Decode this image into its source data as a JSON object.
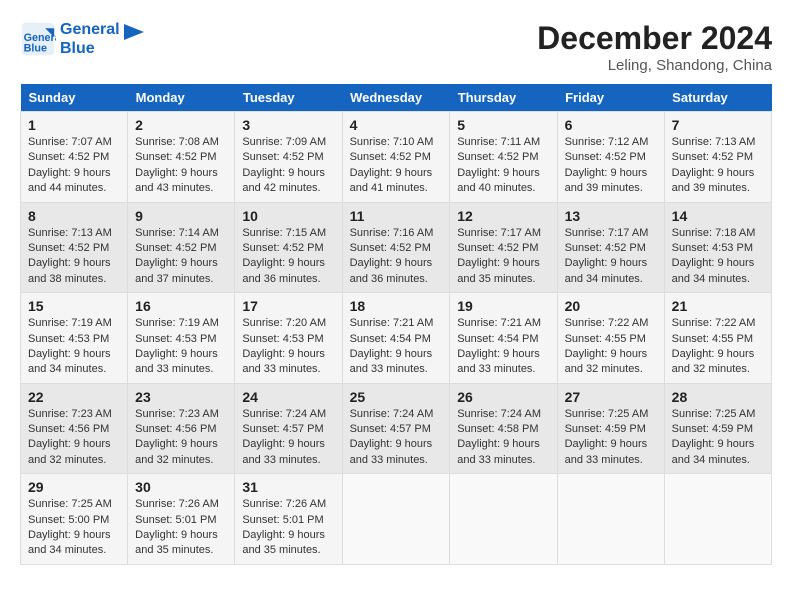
{
  "header": {
    "logo_line1": "General",
    "logo_line2": "Blue",
    "month_title": "December 2024",
    "location": "Leling, Shandong, China"
  },
  "weekdays": [
    "Sunday",
    "Monday",
    "Tuesday",
    "Wednesday",
    "Thursday",
    "Friday",
    "Saturday"
  ],
  "weeks": [
    [
      {
        "day": 1,
        "sunrise": "7:07 AM",
        "sunset": "4:52 PM",
        "daylight": "9 hours and 44 minutes."
      },
      {
        "day": 2,
        "sunrise": "7:08 AM",
        "sunset": "4:52 PM",
        "daylight": "9 hours and 43 minutes."
      },
      {
        "day": 3,
        "sunrise": "7:09 AM",
        "sunset": "4:52 PM",
        "daylight": "9 hours and 42 minutes."
      },
      {
        "day": 4,
        "sunrise": "7:10 AM",
        "sunset": "4:52 PM",
        "daylight": "9 hours and 41 minutes."
      },
      {
        "day": 5,
        "sunrise": "7:11 AM",
        "sunset": "4:52 PM",
        "daylight": "9 hours and 40 minutes."
      },
      {
        "day": 6,
        "sunrise": "7:12 AM",
        "sunset": "4:52 PM",
        "daylight": "9 hours and 39 minutes."
      },
      {
        "day": 7,
        "sunrise": "7:13 AM",
        "sunset": "4:52 PM",
        "daylight": "9 hours and 39 minutes."
      }
    ],
    [
      {
        "day": 8,
        "sunrise": "7:13 AM",
        "sunset": "4:52 PM",
        "daylight": "9 hours and 38 minutes."
      },
      {
        "day": 9,
        "sunrise": "7:14 AM",
        "sunset": "4:52 PM",
        "daylight": "9 hours and 37 minutes."
      },
      {
        "day": 10,
        "sunrise": "7:15 AM",
        "sunset": "4:52 PM",
        "daylight": "9 hours and 36 minutes."
      },
      {
        "day": 11,
        "sunrise": "7:16 AM",
        "sunset": "4:52 PM",
        "daylight": "9 hours and 36 minutes."
      },
      {
        "day": 12,
        "sunrise": "7:17 AM",
        "sunset": "4:52 PM",
        "daylight": "9 hours and 35 minutes."
      },
      {
        "day": 13,
        "sunrise": "7:17 AM",
        "sunset": "4:52 PM",
        "daylight": "9 hours and 34 minutes."
      },
      {
        "day": 14,
        "sunrise": "7:18 AM",
        "sunset": "4:53 PM",
        "daylight": "9 hours and 34 minutes."
      }
    ],
    [
      {
        "day": 15,
        "sunrise": "7:19 AM",
        "sunset": "4:53 PM",
        "daylight": "9 hours and 34 minutes."
      },
      {
        "day": 16,
        "sunrise": "7:19 AM",
        "sunset": "4:53 PM",
        "daylight": "9 hours and 33 minutes."
      },
      {
        "day": 17,
        "sunrise": "7:20 AM",
        "sunset": "4:53 PM",
        "daylight": "9 hours and 33 minutes."
      },
      {
        "day": 18,
        "sunrise": "7:21 AM",
        "sunset": "4:54 PM",
        "daylight": "9 hours and 33 minutes."
      },
      {
        "day": 19,
        "sunrise": "7:21 AM",
        "sunset": "4:54 PM",
        "daylight": "9 hours and 33 minutes."
      },
      {
        "day": 20,
        "sunrise": "7:22 AM",
        "sunset": "4:55 PM",
        "daylight": "9 hours and 32 minutes."
      },
      {
        "day": 21,
        "sunrise": "7:22 AM",
        "sunset": "4:55 PM",
        "daylight": "9 hours and 32 minutes."
      }
    ],
    [
      {
        "day": 22,
        "sunrise": "7:23 AM",
        "sunset": "4:56 PM",
        "daylight": "9 hours and 32 minutes."
      },
      {
        "day": 23,
        "sunrise": "7:23 AM",
        "sunset": "4:56 PM",
        "daylight": "9 hours and 32 minutes."
      },
      {
        "day": 24,
        "sunrise": "7:24 AM",
        "sunset": "4:57 PM",
        "daylight": "9 hours and 33 minutes."
      },
      {
        "day": 25,
        "sunrise": "7:24 AM",
        "sunset": "4:57 PM",
        "daylight": "9 hours and 33 minutes."
      },
      {
        "day": 26,
        "sunrise": "7:24 AM",
        "sunset": "4:58 PM",
        "daylight": "9 hours and 33 minutes."
      },
      {
        "day": 27,
        "sunrise": "7:25 AM",
        "sunset": "4:59 PM",
        "daylight": "9 hours and 33 minutes."
      },
      {
        "day": 28,
        "sunrise": "7:25 AM",
        "sunset": "4:59 PM",
        "daylight": "9 hours and 34 minutes."
      }
    ],
    [
      {
        "day": 29,
        "sunrise": "7:25 AM",
        "sunset": "5:00 PM",
        "daylight": "9 hours and 34 minutes."
      },
      {
        "day": 30,
        "sunrise": "7:26 AM",
        "sunset": "5:01 PM",
        "daylight": "9 hours and 35 minutes."
      },
      {
        "day": 31,
        "sunrise": "7:26 AM",
        "sunset": "5:01 PM",
        "daylight": "9 hours and 35 minutes."
      },
      null,
      null,
      null,
      null
    ]
  ]
}
